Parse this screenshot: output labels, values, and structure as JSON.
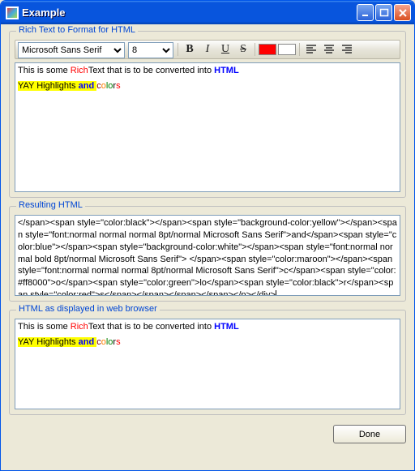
{
  "window": {
    "title": "Example"
  },
  "group1": {
    "legend": "Rich Text to Format for HTML",
    "font_name": "Microsoft Sans Serif",
    "font_size": "8",
    "btn_bold": "B",
    "btn_italic": "I",
    "btn_under": "U",
    "btn_strike": "S",
    "forecolor": "#ff0000",
    "backcolor": "#ffffff",
    "line1": {
      "a": "This is some ",
      "rich": "Rich",
      "text": "Text",
      "b": " that is to be converted into ",
      "html": "HTML"
    },
    "line2": {
      "yay": "YAY Highlights",
      "and": " and ",
      "c": "c",
      "o": "o",
      "lo": "lo",
      "r": "r",
      "s": "s"
    }
  },
  "group2": {
    "legend": "Resulting HTML",
    "html": "</span><span style=\"color:black\"></span><span style=\"background-color:yellow\"></span><span style=\"font:normal normal normal 8pt/normal Microsoft Sans Serif\">and</span><span style=\"color:blue\"></span><span style=\"background-color:white\"></span><span style=\"font:normal normal bold 8pt/normal Microsoft Sans Serif\"> </span><span style=\"color:maroon\"></span><span style=\"font:normal normal normal 8pt/normal Microsoft Sans Serif\">c</span><span style=\"color:#ff8000\">o</span><span style=\"color:green\">lo</span><span style=\"color:black\">r</span><span style=\"color:red\">s</span></span></span></span></p></div>"
  },
  "group3": {
    "legend": "HTML as displayed in web browser"
  },
  "done": "Done"
}
